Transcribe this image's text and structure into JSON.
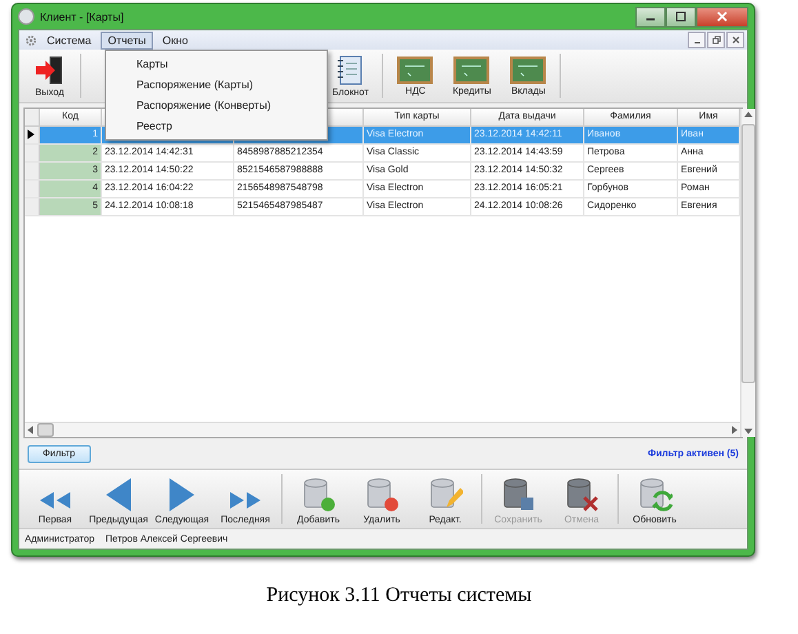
{
  "window": {
    "title": "Клиент - [Карты]"
  },
  "menu_bar": [
    {
      "label": "Система",
      "selected": false
    },
    {
      "label": "Отчеты",
      "selected": true
    },
    {
      "label": "Окно",
      "selected": false
    }
  ],
  "open_menu": {
    "items": [
      "Карты",
      "Распоряжение (Карты)",
      "Распоряжение (Конверты)",
      "Реестр"
    ]
  },
  "toolbar": [
    {
      "label": "Выход",
      "kind": "exit"
    },
    {
      "label": "Блокнот",
      "kind": "notebook"
    },
    {
      "label": "НДС",
      "kind": "board"
    },
    {
      "label": "Кредиты",
      "kind": "board"
    },
    {
      "label": "Вклады",
      "kind": "board"
    }
  ],
  "table": {
    "columns": [
      {
        "label": "Код"
      },
      {},
      {},
      {
        "label": "Тип карты"
      },
      {
        "label": "Дата выдачи"
      },
      {
        "label": "Фамилия"
      },
      {
        "label": "Имя"
      }
    ],
    "rows": [
      {
        "selected": true,
        "cells": [
          "1",
          null,
          null,
          "Visa Electron",
          "23.12.2014 14:42:11",
          "Иванов",
          "Иван"
        ]
      },
      {
        "selected": false,
        "cells": [
          "2",
          "23.12.2014 14:42:31",
          "8458987885212354",
          "Visa Classic",
          "23.12.2014 14:43:59",
          "Петрова",
          "Анна"
        ]
      },
      {
        "selected": false,
        "cells": [
          "3",
          "23.12.2014 14:50:22",
          "8521546587988888",
          "Visa Gold",
          "23.12.2014 14:50:32",
          "Сергеев",
          "Евгений"
        ]
      },
      {
        "selected": false,
        "cells": [
          "4",
          "23.12.2014 16:04:22",
          "2156548987548798",
          "Visa Electron",
          "23.12.2014 16:05:21",
          "Горбунов",
          "Роман"
        ]
      },
      {
        "selected": false,
        "cells": [
          "5",
          "24.12.2014 10:08:18",
          "5215465487985487",
          "Visa Electron",
          "24.12.2014 10:08:26",
          "Сидоренко",
          "Евгения"
        ]
      }
    ]
  },
  "filter_button": "Фильтр",
  "filter_status": "Фильтр активен (5)",
  "nav_toolbar": [
    {
      "label": "Первая",
      "kind": "first",
      "disabled": false
    },
    {
      "label": "Предыдущая",
      "kind": "prev",
      "disabled": false
    },
    {
      "label": "Следующая",
      "kind": "next",
      "disabled": false
    },
    {
      "label": "Последняя",
      "kind": "last",
      "disabled": false
    },
    {
      "label": "Добавить",
      "kind": "add",
      "disabled": false
    },
    {
      "label": "Удалить",
      "kind": "delete",
      "disabled": false
    },
    {
      "label": "Редакт.",
      "kind": "edit",
      "disabled": false
    },
    {
      "label": "Сохранить",
      "kind": "save",
      "disabled": true
    },
    {
      "label": "Отмена",
      "kind": "cancel",
      "disabled": true
    },
    {
      "label": "Обновить",
      "kind": "refresh",
      "disabled": false
    }
  ],
  "status_bar": [
    "Администратор",
    "Петров Алексей Сергеевич"
  ],
  "caption": "Рисунок 3.11 Отчеты системы"
}
